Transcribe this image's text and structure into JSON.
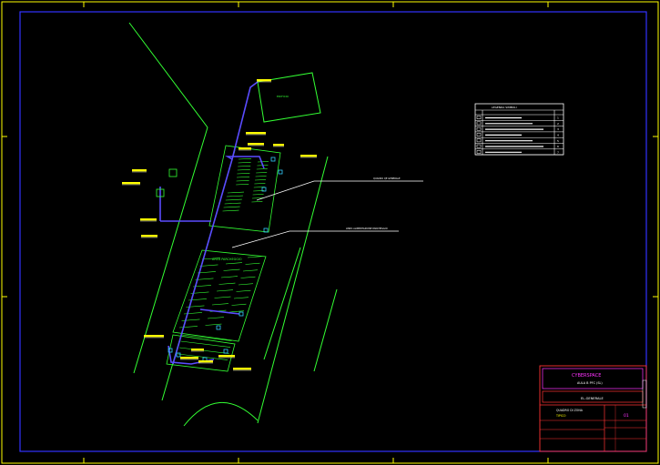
{
  "colors": {
    "background": "#000000",
    "site_lines": "#33ff33",
    "conduit": "#5a4cff",
    "labels": "#ffff00",
    "frame": "#3333ff",
    "company": "#ff33ff",
    "leader_lines": "#ffffff"
  },
  "drawing": {
    "area_label": "AREA PARCHEGGIO"
  },
  "legend": {
    "title": "LEGENDA SIMBOLI",
    "rows": [
      "1",
      "2",
      "3",
      "4",
      "5",
      "6",
      "7"
    ]
  },
  "title_block": {
    "company": "CYBERSPACE",
    "location": "AULA B PFC (SL)",
    "drawing_title": "EL-GENERALE",
    "project_line1": "QUADRO DI ZONA",
    "project_line2": "TIPICO",
    "sheet": "01"
  }
}
